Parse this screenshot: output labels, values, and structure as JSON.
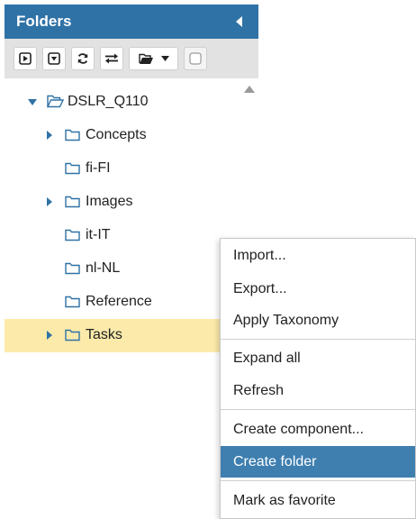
{
  "panel": {
    "title": "Folders",
    "collapse_icon": "chevron-left-icon"
  },
  "toolbar": {
    "buttons": [
      {
        "name": "expand-button",
        "icon": "play-square-icon"
      },
      {
        "name": "collapse-button",
        "icon": "caret-down-square-icon"
      },
      {
        "name": "refresh-button",
        "icon": "refresh-icon"
      },
      {
        "name": "sync-button",
        "icon": "exchange-icon"
      },
      {
        "name": "folder-menu-button",
        "icon": "folder-open-icon"
      },
      {
        "name": "select-checkbox",
        "icon": "checkbox-icon"
      }
    ]
  },
  "tree": {
    "root": {
      "label": "DSLR_Q110",
      "expanded": true
    },
    "children": [
      {
        "label": "Concepts",
        "has_children": true
      },
      {
        "label": "fi-FI",
        "has_children": false
      },
      {
        "label": "Images",
        "has_children": true
      },
      {
        "label": "it-IT",
        "has_children": false
      },
      {
        "label": "nl-NL",
        "has_children": false
      },
      {
        "label": "Reference",
        "has_children": false
      },
      {
        "label": "Tasks",
        "has_children": true,
        "selected": true
      }
    ]
  },
  "context_menu": {
    "groups": [
      [
        "Import...",
        "Export...",
        "Apply Taxonomy"
      ],
      [
        "Expand all",
        "Refresh"
      ],
      [
        "Create component...",
        "Create folder"
      ],
      [
        "Mark as favorite"
      ]
    ],
    "active_item": "Create folder"
  },
  "colors": {
    "header": "#2f72a6",
    "selected_row": "#fbeaaa",
    "menu_active": "#3e7fb0"
  }
}
